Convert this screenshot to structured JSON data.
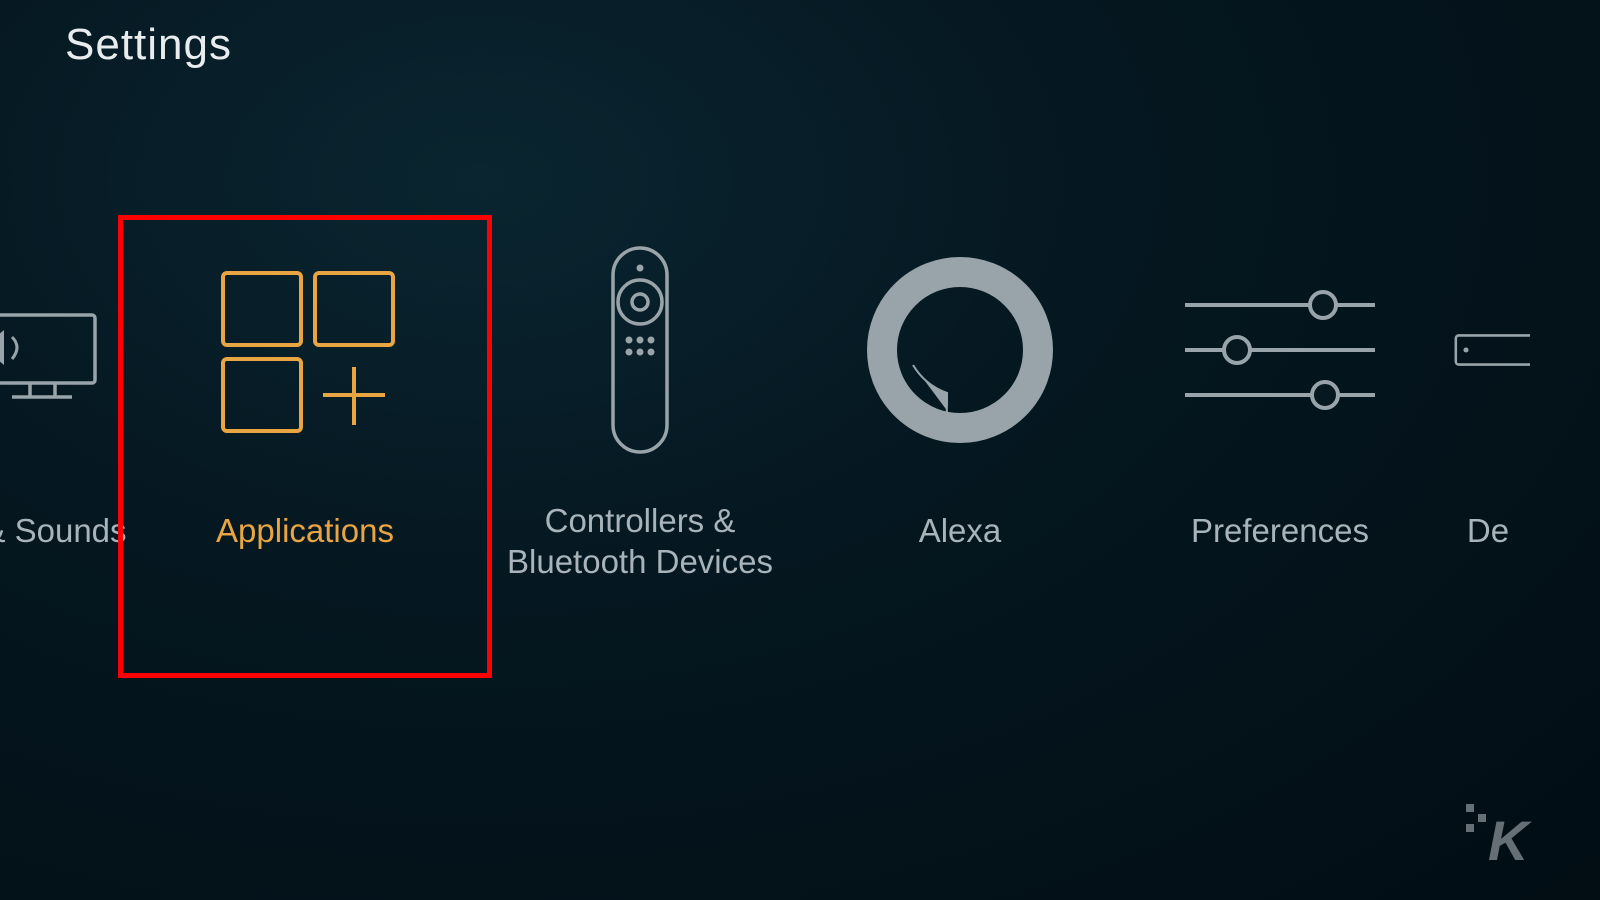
{
  "page": {
    "title": "Settings"
  },
  "tiles": {
    "display_sounds": {
      "label": "& Sounds"
    },
    "applications": {
      "label": "Applications",
      "selected": true
    },
    "controllers": {
      "label": "Controllers & Bluetooth Devices"
    },
    "alexa": {
      "label": "Alexa"
    },
    "preferences": {
      "label": "Preferences"
    },
    "device": {
      "label": "De"
    }
  },
  "colors": {
    "accent": "#e8a542",
    "muted": "#98a4a9",
    "highlight_box": "#ff0000"
  },
  "watermark": {
    "text": "K"
  }
}
